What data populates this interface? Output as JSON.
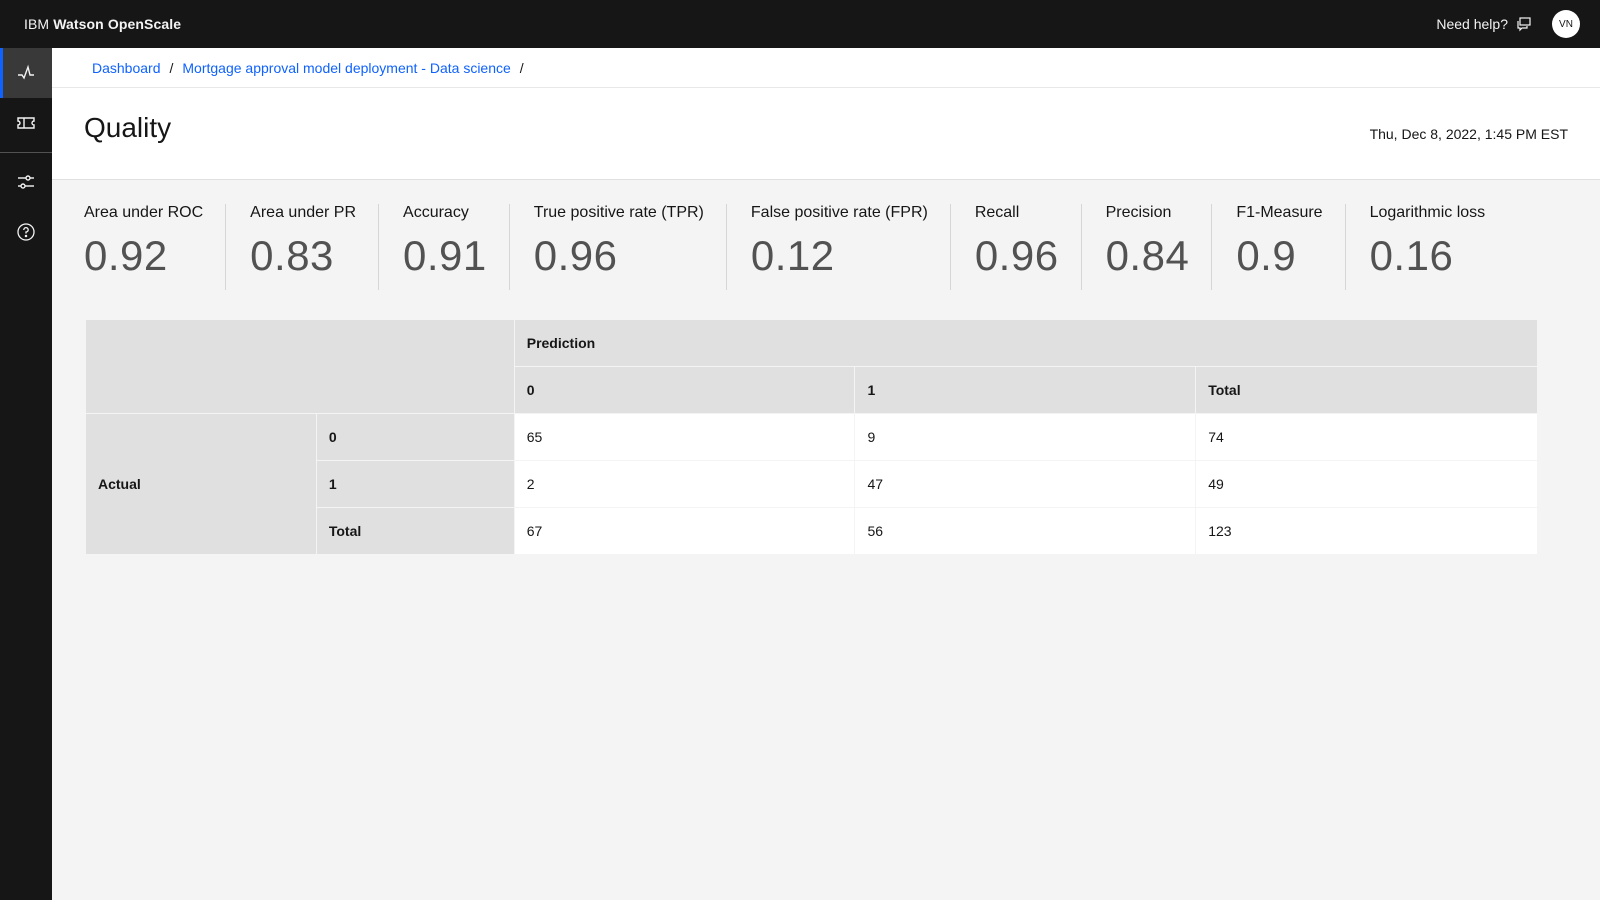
{
  "header": {
    "brand_prefix": "IBM",
    "brand_name": "Watson OpenScale",
    "help_label": "Need help?",
    "avatar_initials": "VN"
  },
  "rail": {
    "items": [
      {
        "icon": "activity-icon",
        "active": true
      },
      {
        "icon": "ticket-icon",
        "active": false
      },
      {
        "icon": "sliders-icon",
        "active": false
      },
      {
        "icon": "help-icon",
        "active": false
      }
    ]
  },
  "breadcrumb": {
    "items": [
      "Dashboard",
      "Mortgage approval model deployment - Data science"
    ],
    "separator": "/"
  },
  "page": {
    "title": "Quality",
    "timestamp": "Thu, Dec 8, 2022, 1:45 PM EST"
  },
  "metrics": [
    {
      "label": "Area under ROC",
      "value": "0.92"
    },
    {
      "label": "Area under PR",
      "value": "0.83"
    },
    {
      "label": "Accuracy",
      "value": "0.91"
    },
    {
      "label": "True positive rate (TPR)",
      "value": "0.96"
    },
    {
      "label": "False positive rate (FPR)",
      "value": "0.12"
    },
    {
      "label": "Recall",
      "value": "0.96"
    },
    {
      "label": "Precision",
      "value": "0.84"
    },
    {
      "label": "F1-Measure",
      "value": "0.9"
    },
    {
      "label": "Logarithmic loss",
      "value": "0.16"
    }
  ],
  "matrix": {
    "prediction_label": "Prediction",
    "actual_label": "Actual",
    "col_headers": [
      "0",
      "1",
      "Total"
    ],
    "rows": [
      {
        "label": "0",
        "values": [
          "65",
          "9",
          "74"
        ]
      },
      {
        "label": "1",
        "values": [
          "2",
          "47",
          "49"
        ]
      },
      {
        "label": "Total",
        "values": [
          "67",
          "56",
          "123"
        ]
      }
    ]
  },
  "colors": {
    "accent": "#0f62fe",
    "header_bg": "#161616",
    "table_header_bg": "#e0e0e0"
  }
}
